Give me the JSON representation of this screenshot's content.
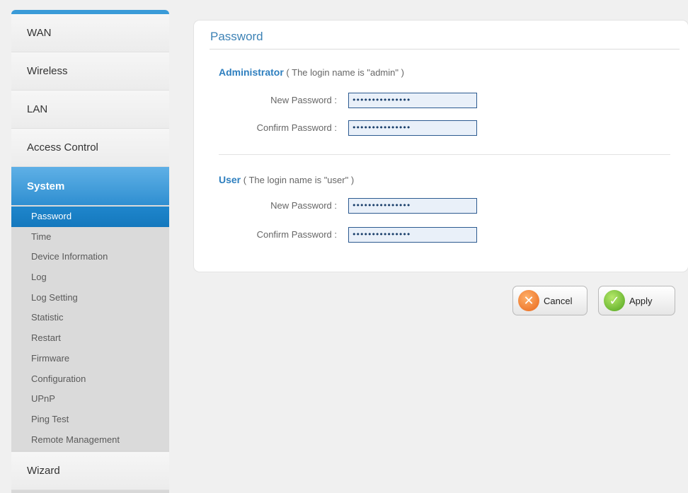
{
  "sidebar": {
    "menus": {
      "wan": "WAN",
      "wireless": "Wireless",
      "lan": "LAN",
      "access_control": "Access Control",
      "system": "System",
      "wizard": "Wizard"
    },
    "system_items": [
      "Password",
      "Time",
      "Device Information",
      "Log",
      "Log Setting",
      "Statistic",
      "Restart",
      "Firmware",
      "Configuration",
      "UPnP",
      "Ping Test",
      "Remote Management"
    ],
    "selected_item": "Password"
  },
  "panel": {
    "title": "Password",
    "admin": {
      "heading": "Administrator",
      "note": "( The login name is \"admin\" )",
      "new_label": "New Password :",
      "new_value": "•••••••••••••••",
      "confirm_label": "Confirm Password :",
      "confirm_value": "•••••••••••••••"
    },
    "user": {
      "heading": "User",
      "note": "( The login name is \"user\" )",
      "new_label": "New Password :",
      "new_value": "•••••••••••••••",
      "confirm_label": "Confirm Password :",
      "confirm_value": "•••••••••••••••"
    }
  },
  "buttons": {
    "cancel": "Cancel",
    "apply": "Apply",
    "cancel_icon": "x-circle-icon",
    "apply_icon": "check-circle-icon"
  },
  "colors": {
    "accent": "#2f8fd1",
    "title": "#3d82b5"
  }
}
